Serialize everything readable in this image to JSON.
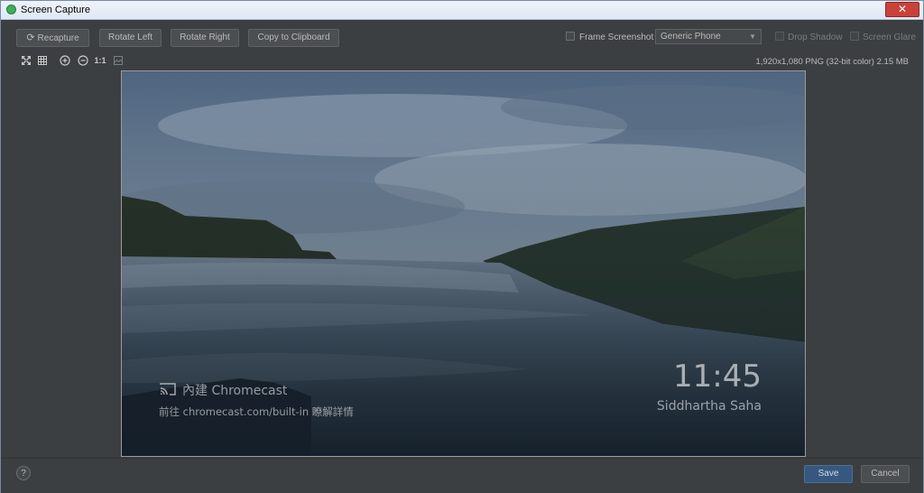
{
  "window": {
    "title": "Screen Capture",
    "close_glyph": "✕"
  },
  "toolbar": {
    "recapture_icon": "refresh-icon",
    "recapture_label": "Recapture",
    "rotate_left_label": "Rotate Left",
    "rotate_right_label": "Rotate Right",
    "copy_label": "Copy to Clipboard",
    "frame_screenshot_label": "Frame Screenshot",
    "frame_screenshot_checked": false,
    "device_select_value": "Generic Phone",
    "drop_shadow_label": "Drop Shadow",
    "drop_shadow_enabled": false,
    "screen_glare_label": "Screen Glare",
    "screen_glare_enabled": false
  },
  "viewer_tools": {
    "fit_icon": "fit-screen-icon",
    "grid_icon": "grid-icon",
    "zoom_in_icon": "zoom-in-icon",
    "zoom_out_icon": "zoom-out-icon",
    "actual_size_label": "1:1",
    "overlay_icon": "image-overlay-icon"
  },
  "image_info": "1,920x1,080 PNG (32-bit color) 2.15 MB",
  "screenshot": {
    "cast_label": "內建 Chromecast",
    "cast_sub": "前往 chromecast.com/built-in 瞭解詳情",
    "time": "11:45",
    "credit": "Siddhartha Saha",
    "colors": {
      "sky_top": "#5a6e86",
      "sky_mid": "#8ea2b6",
      "water": "#5f7284",
      "cliff": "#243026"
    }
  },
  "footer": {
    "help_label": "?",
    "save_label": "Save",
    "cancel_label": "Cancel",
    "accent": "#365880"
  }
}
